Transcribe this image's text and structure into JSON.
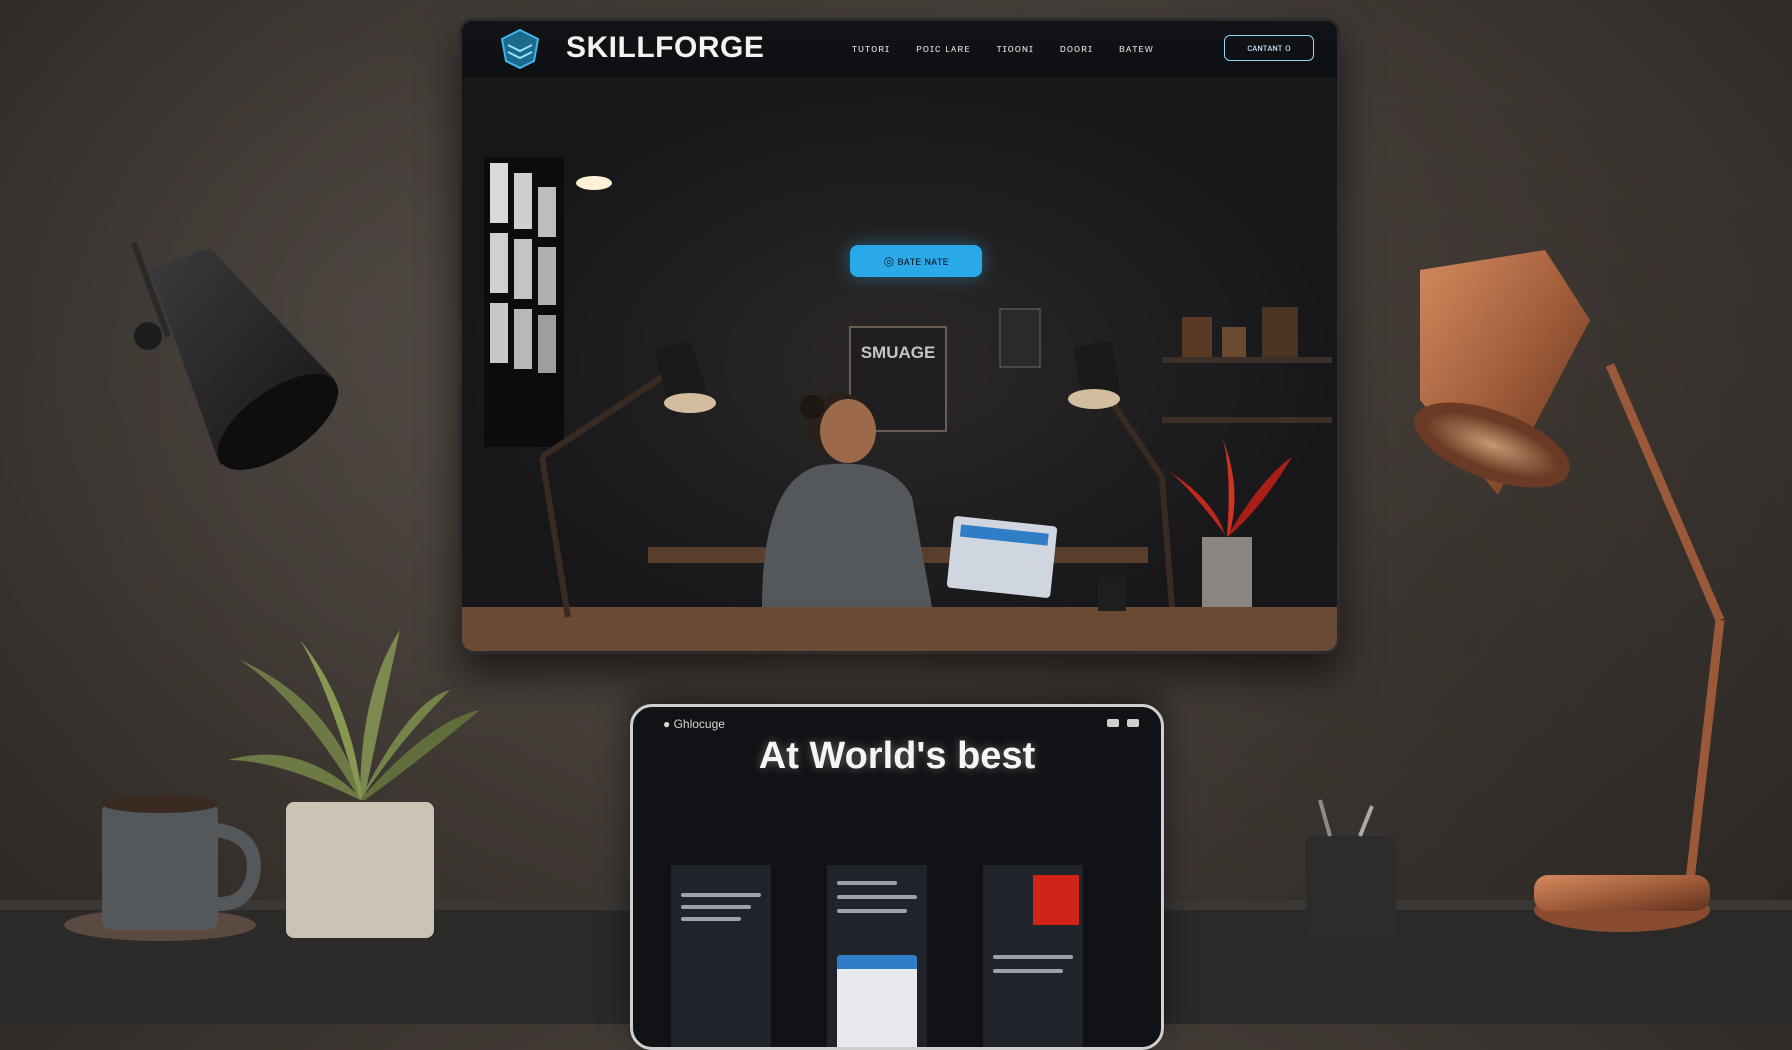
{
  "monitor": {
    "brand": "SKILLFORGE",
    "nav_links": [
      "ᴛᴜᴛᴏʀɪ",
      "ᴘᴏɪᴄ ʟᴀʀᴇ",
      "ᴛɪᴏᴏɴɪ",
      "ᴅᴏᴏʀɪ",
      "ʙᴀᴛᴇᴡ"
    ],
    "nav_button": "ᴄᴀɴᴛᴀɴᴛ ᴏ",
    "hero_button": "◎ ʙᴀᴛᴇ ɴᴀᴛᴇ",
    "sign_text": "SMUAGE"
  },
  "tablet": {
    "brand": "● Ghlocuge",
    "headline": "At World's best"
  },
  "colors": {
    "accent": "#2aa9e8",
    "logo": "#3fb7ea",
    "copper": "#b06a45",
    "wall": "#4a433d"
  }
}
